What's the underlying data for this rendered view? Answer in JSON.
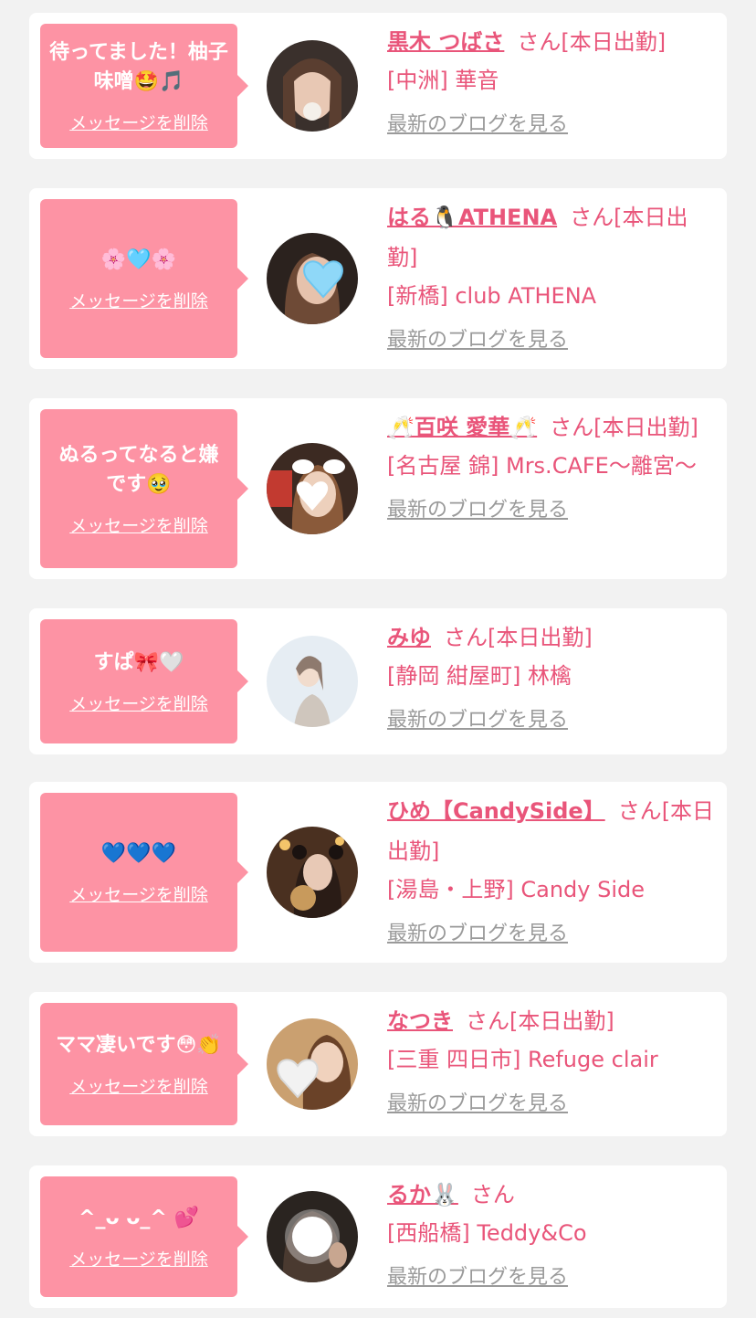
{
  "cards": [
    {
      "message": "待ってました！柚子味噌🤩🎵",
      "delete_label": "メッセージを削除",
      "name": "黒木 つばさ",
      "honorific": "さん",
      "status": "[本日出勤]",
      "shop": "[中洲] 華音",
      "blog_label": "最新のブログを見る"
    },
    {
      "message": "🌸🩵🌸",
      "delete_label": "メッセージを削除",
      "name": "はる🐧ATHENA",
      "honorific": "さん",
      "status": "[本日出勤]",
      "shop": "[新橋] club ATHENA",
      "blog_label": "最新のブログを見る"
    },
    {
      "message": "ぬるってなると嫌です🥹",
      "delete_label": "メッセージを削除",
      "name": "🥂百咲 愛華🥂",
      "honorific": "さん",
      "status": "[本日出勤]",
      "shop": "[名古屋 錦] Mrs.CAFE〜離宮〜",
      "blog_label": "最新のブログを見る"
    },
    {
      "message": "すぱ🎀🤍",
      "delete_label": "メッセージを削除",
      "name": "みゆ",
      "honorific": "さん",
      "status": "[本日出勤]",
      "shop": "[静岡 紺屋町] 林檎",
      "blog_label": "最新のブログを見る"
    },
    {
      "message": "💙💙💙",
      "delete_label": "メッセージを削除",
      "name": "ひめ【CandySide】",
      "honorific": "さん",
      "status": "[本日出勤]",
      "shop": "[湯島・上野] Candy Side",
      "blog_label": "最新のブログを見る"
    },
    {
      "message": "ママ凄いです😳👏",
      "delete_label": "メッセージを削除",
      "name": "なつき",
      "honorific": "さん",
      "status": "[本日出勤]",
      "shop": "[三重 四日市] Refuge clair",
      "blog_label": "最新のブログを見る"
    },
    {
      "message": "^_ᴗ ᴗ_^ 💕",
      "delete_label": "メッセージを削除",
      "name": "るか🐰",
      "honorific": "さん",
      "status": "",
      "shop": "[西船橋] Teddy&Co",
      "blog_label": "最新のブログを見る"
    }
  ],
  "colors": {
    "page_bg": "#f2f2f2",
    "bubble": "#fd93a4",
    "accent_text": "#e9557a",
    "muted_link": "#9a9a9a"
  }
}
